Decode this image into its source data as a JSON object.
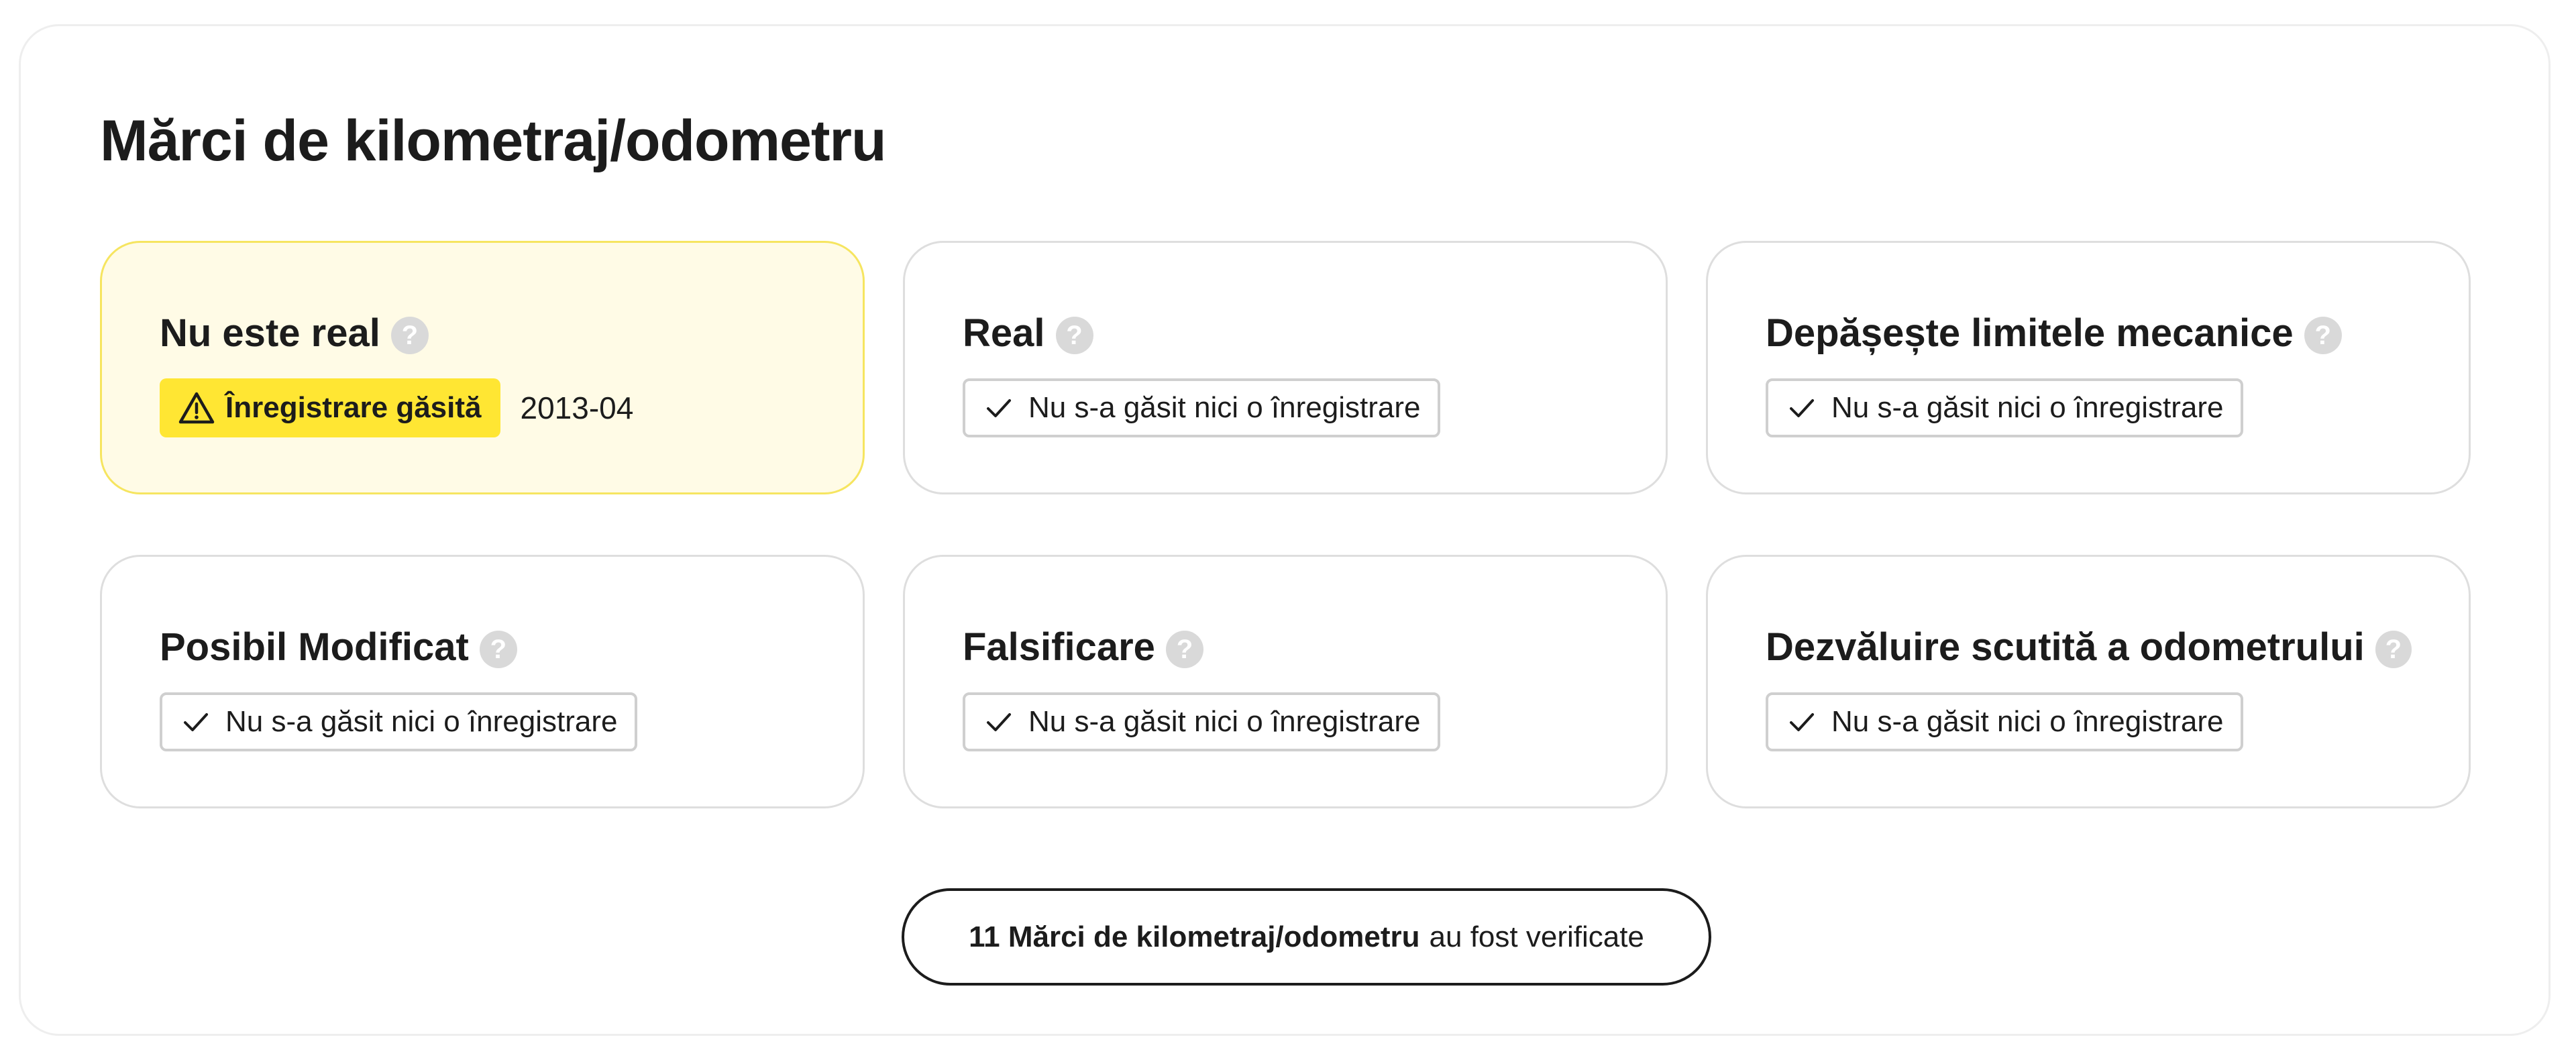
{
  "section": {
    "title": "Mărci de kilometraj/odometru"
  },
  "cards": [
    {
      "title": "Nu este real",
      "help_icon": "?",
      "status": "warning",
      "badge_label": "Înregistrare găsită",
      "date": "2013-04"
    },
    {
      "title": "Real",
      "help_icon": "?",
      "status": "ok",
      "badge_label": "Nu s-a găsit nici o înregistrare"
    },
    {
      "title": "Depășește limitele mecanice",
      "help_icon": "?",
      "status": "ok",
      "badge_label": "Nu s-a găsit nici o înregistrare"
    },
    {
      "title": "Posibil Modificat",
      "help_icon": "?",
      "status": "ok",
      "badge_label": "Nu s-a găsit nici o înregistrare"
    },
    {
      "title": "Falsificare",
      "help_icon": "?",
      "status": "ok",
      "badge_label": "Nu s-a găsit nici o înregistrare"
    },
    {
      "title": "Dezvăluire scutită a odometrului",
      "help_icon": "?",
      "status": "ok",
      "badge_label": "Nu s-a găsit nici o înregistrare"
    }
  ],
  "summary": {
    "count_label": "11 Mărci de kilometraj/odometru",
    "suffix": "au fost verificate"
  },
  "colors": {
    "warning_bg": "#fffbe6",
    "warning_border": "#f6e560",
    "warning_badge": "#ffe633",
    "text": "#1c1c1c",
    "help_icon_bg": "#d9d9d9"
  },
  "icons": {
    "help": "question-circle-icon",
    "ok": "checkmark-icon",
    "warning": "warning-triangle-icon"
  }
}
